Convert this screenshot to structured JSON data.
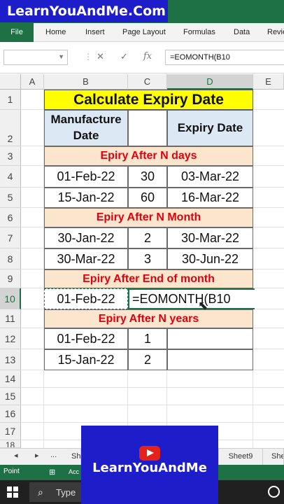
{
  "brand": {
    "banner_text": "LearnYouAndMe.Com",
    "logo_text": "LearnYouAndMe"
  },
  "ribbon": {
    "tabs": [
      "File",
      "Home",
      "Insert",
      "Page Layout",
      "Formulas",
      "Data",
      "Revie"
    ]
  },
  "formula_bar": {
    "cancel_icon": "✕",
    "enter_icon": "✓",
    "fx_label": "fx",
    "formula": "=EOMONTH(B10"
  },
  "columns": [
    "A",
    "B",
    "C",
    "D",
    "E"
  ],
  "rows": [
    "1",
    "2",
    "3",
    "4",
    "5",
    "6",
    "7",
    "8",
    "9",
    "10",
    "11",
    "12",
    "13",
    "14",
    "15",
    "16",
    "17",
    "18"
  ],
  "sheet": {
    "title": "Calculate Expiry Date",
    "header_manufacture": "Manufacture\nDate",
    "header_expiry": "Expiry Date",
    "sections": [
      "Epiry After N days",
      "Epiry After N Month",
      "Epiry After End of month",
      "Epiry After N years"
    ],
    "days_rows": [
      {
        "date": "01-Feb-22",
        "n": "30",
        "expiry": "03-Mar-22"
      },
      {
        "date": "15-Jan-22",
        "n": "60",
        "expiry": "16-Mar-22"
      }
    ],
    "month_rows": [
      {
        "date": "30-Jan-22",
        "n": "2",
        "expiry": "30-Mar-22"
      },
      {
        "date": "30-Mar-22",
        "n": "3",
        "expiry": "30-Jun-22"
      }
    ],
    "eom_row": {
      "date": "01-Feb-22",
      "formula": "=EOMONTH(B10"
    },
    "year_rows": [
      {
        "date": "01-Feb-22",
        "n": "1"
      },
      {
        "date": "15-Jan-22",
        "n": "2"
      }
    ]
  },
  "sheet_tabs": [
    "◂",
    "▸",
    "...",
    "Sh",
    "Sheet9",
    "She"
  ],
  "status": {
    "mode": "Point",
    "accessibility": "Acc"
  },
  "taskbar": {
    "search_placeholder": "Type"
  },
  "colors": {
    "excel_green": "#1e7145",
    "brand_blue": "#1d1dc9",
    "title_yellow": "#ffff00",
    "header_blue": "#dde8f5",
    "section_peach": "#fbe5cc",
    "section_red": "#e0000e"
  },
  "icons": [
    "windows-logo-icon",
    "search-icon",
    "cortana-icon",
    "youtube-play-icon",
    "dropdown-caret-icon",
    "mouse-cursor-icon"
  ]
}
